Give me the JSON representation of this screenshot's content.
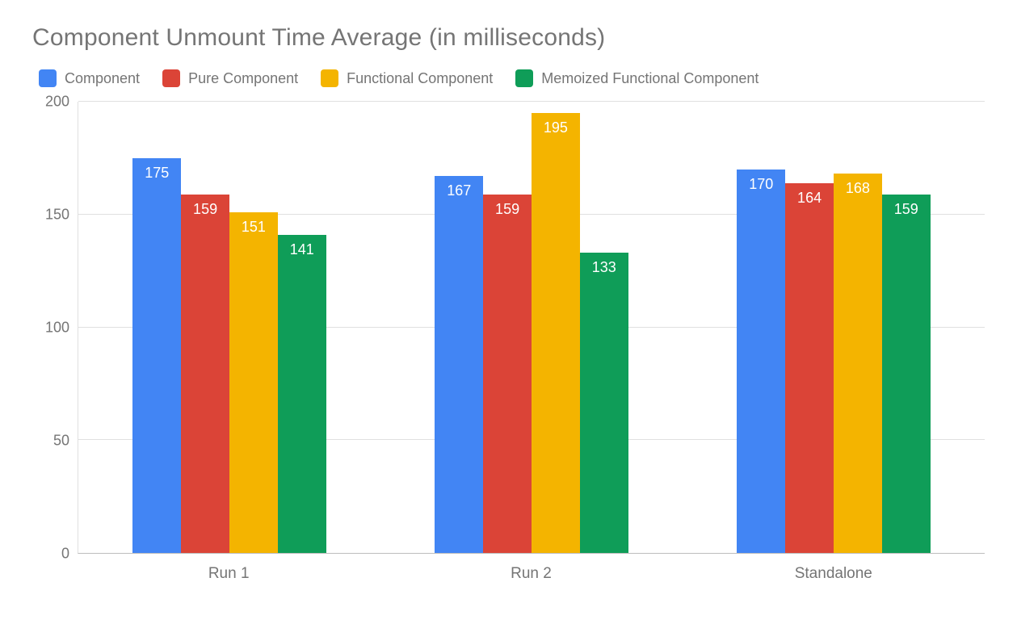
{
  "chart_data": {
    "type": "bar",
    "title": "Component Unmount Time Average (in milliseconds)",
    "xlabel": "",
    "ylabel": "",
    "ylim": [
      0,
      200
    ],
    "yticks": [
      0,
      50,
      100,
      150,
      200
    ],
    "categories": [
      "Run 1",
      "Run 2",
      "Standalone"
    ],
    "series": [
      {
        "name": "Component",
        "color": "#4285F4",
        "values": [
          175,
          167,
          170
        ]
      },
      {
        "name": "Pure Component",
        "color": "#DB4437",
        "values": [
          159,
          159,
          164
        ]
      },
      {
        "name": "Functional Component",
        "color": "#F4B400",
        "values": [
          151,
          195,
          168
        ]
      },
      {
        "name": "Memoized Functional Component",
        "color": "#0F9D58",
        "values": [
          141,
          133,
          159
        ]
      }
    ]
  }
}
